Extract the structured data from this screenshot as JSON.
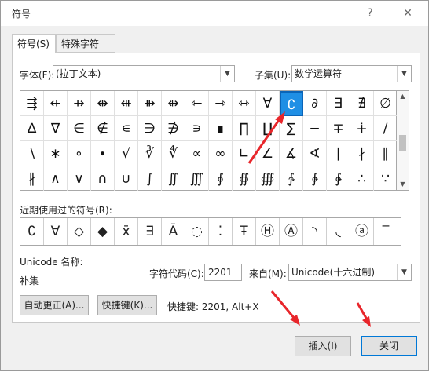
{
  "window": {
    "title": "符号",
    "help_icon": "?",
    "close_icon": "✕"
  },
  "tabs": [
    {
      "label": "符号(S)"
    },
    {
      "label": "特殊字符(P)"
    }
  ],
  "font": {
    "label": "字体(F):",
    "value": "(拉丁文本)"
  },
  "subset": {
    "label": "子集(U):",
    "value": "数学运算符"
  },
  "symbols": [
    [
      "⇶",
      "⇷",
      "⇸",
      "⇹",
      "⇺",
      "⇻",
      "⇼",
      "⇽",
      "⇾",
      "⇿",
      "∀",
      "∁",
      "∂",
      "∃",
      "∄",
      "∅"
    ],
    [
      "∆",
      "∇",
      "∈",
      "∉",
      "∊",
      "∋",
      "∌",
      "∍",
      "∎",
      "∏",
      "∐",
      "∑",
      "−",
      "∓",
      "∔",
      "∕"
    ],
    [
      "∖",
      "∗",
      "∘",
      "∙",
      "√",
      "∛",
      "∜",
      "∝",
      "∞",
      "∟",
      "∠",
      "∡",
      "∢",
      "∣",
      "∤",
      "∥"
    ],
    [
      "∦",
      "∧",
      "∨",
      "∩",
      "∪",
      "∫",
      "∬",
      "∭",
      "∮",
      "∯",
      "∰",
      "∱",
      "∲",
      "∳",
      "∴",
      "∵"
    ]
  ],
  "selected_symbol": "∁",
  "recent": {
    "label": "近期使用过的符号(R):",
    "items": [
      "∁",
      "∀",
      "◇",
      "◆",
      "x̄",
      "∃",
      "Ā",
      "◌",
      "⁚",
      "Ŧ",
      "Ⓗ",
      "Ⓐ",
      "◝",
      "◟",
      "ⓐ",
      "‾"
    ]
  },
  "unicode_name": {
    "label": "Unicode 名称:",
    "value": "补集"
  },
  "char_code": {
    "label": "字符代码(C):",
    "value": "2201"
  },
  "from": {
    "label": "来自(M):",
    "value": "Unicode(十六进制)"
  },
  "autocorrect_button": "自动更正(A)...",
  "shortcut_button": "快捷键(K)...",
  "shortcut_text": "快捷键: 2201, Alt+X",
  "insert_button": "插入(I)",
  "close_button": "关闭",
  "annotation_color": "#e8262b",
  "accent_color": "#0078d7"
}
